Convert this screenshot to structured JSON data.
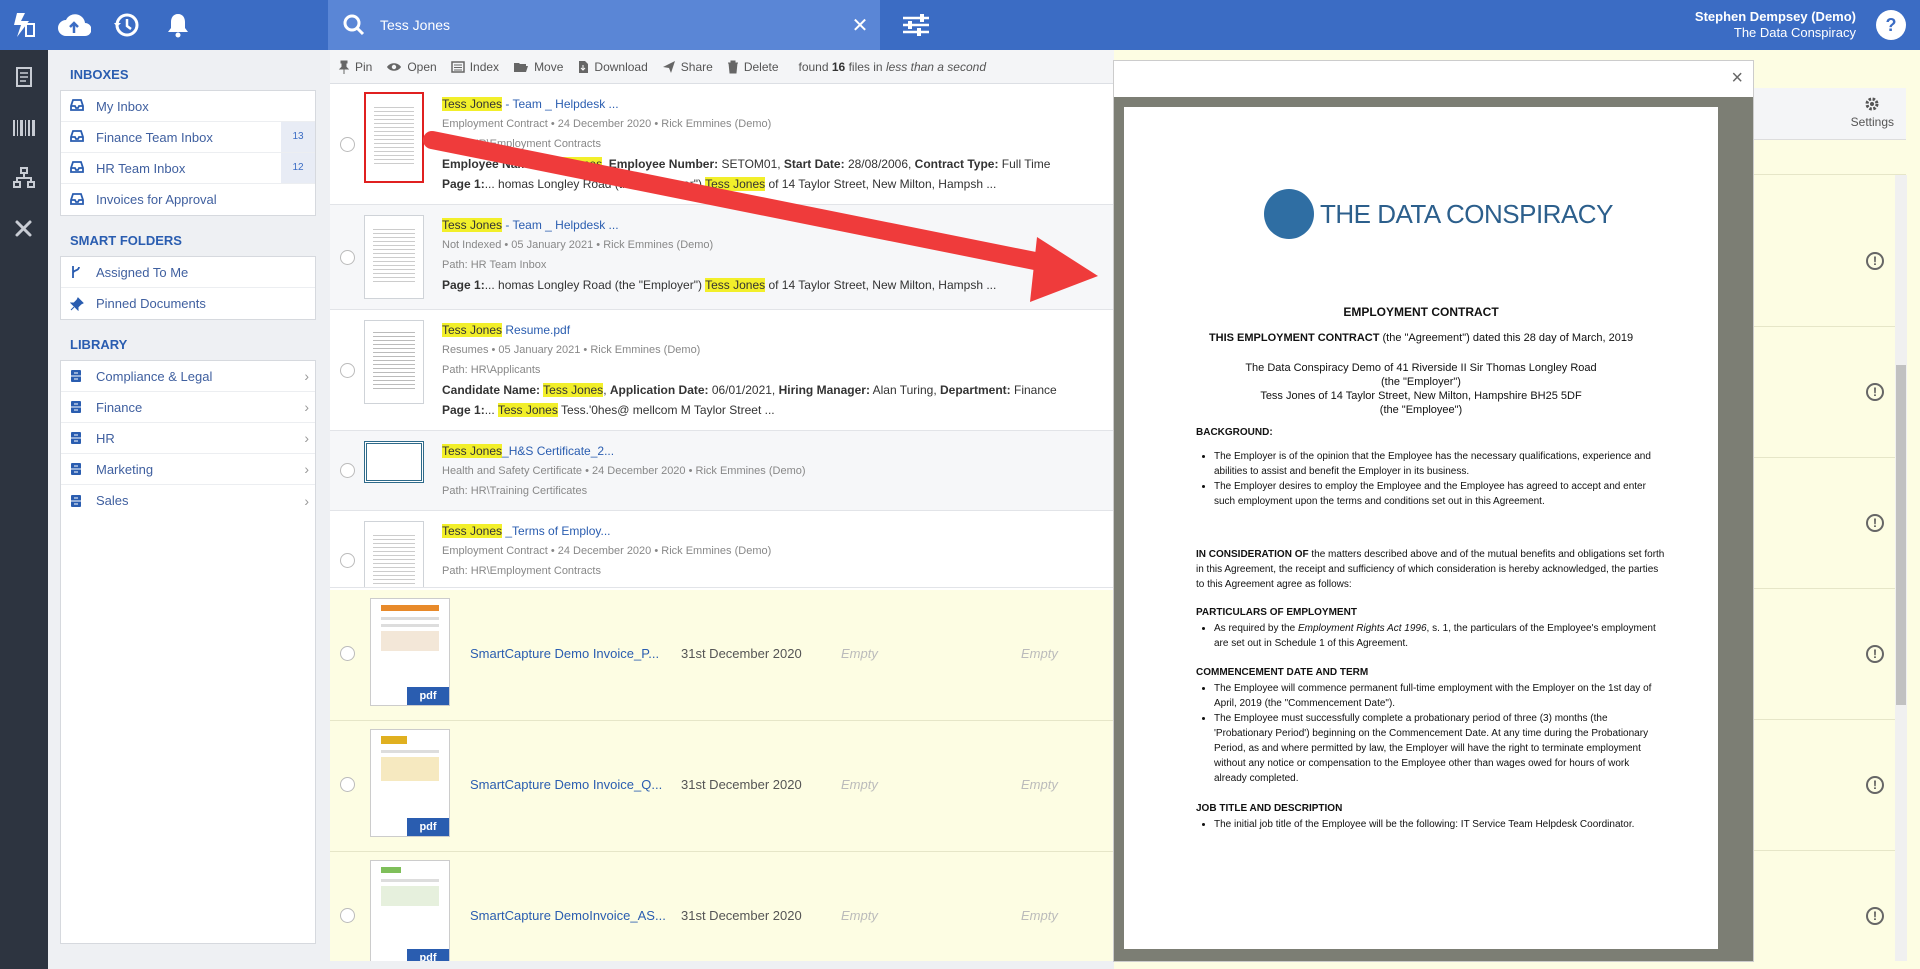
{
  "topbar": {
    "search_value": "Tess Jones",
    "user_name": "Stephen Dempsey (Demo)",
    "company": "The Data Conspiracy",
    "help_label": "?",
    "clear_label": "✕"
  },
  "sidebar": {
    "inboxes_title": "INBOXES",
    "inboxes": [
      {
        "label": "My Inbox",
        "count": ""
      },
      {
        "label": "Finance Team Inbox",
        "count": "13"
      },
      {
        "label": "HR Team Inbox",
        "count": "12"
      },
      {
        "label": "Invoices for Approval",
        "count": ""
      }
    ],
    "smart_title": "SMART FOLDERS",
    "smart": [
      {
        "label": "Assigned To Me"
      },
      {
        "label": "Pinned Documents"
      }
    ],
    "library_title": "LIBRARY",
    "library": [
      {
        "label": "Compliance & Legal"
      },
      {
        "label": "Finance"
      },
      {
        "label": "HR"
      },
      {
        "label": "Marketing"
      },
      {
        "label": "Sales"
      }
    ]
  },
  "toolbar": {
    "pin": "Pin",
    "open": "Open",
    "index": "Index",
    "move": "Move",
    "download": "Download",
    "share": "Share",
    "delete": "Delete",
    "found_prefix": "found",
    "found_count": "16",
    "found_mid": "files in",
    "found_time": "less than a second"
  },
  "results": [
    {
      "hl": "Tess Jones",
      "title": " - Team _ Helpdesk ...",
      "meta": "Employment Contract • 24 December 2020 • Rick Emmines (Demo)",
      "path": "Path: HR\\Employment Contracts",
      "t1a": "Employee Name: ",
      "t1hl": "Tess Jones",
      "t1b": ", ",
      "t1c": "Employee Number:",
      "t1d": " SETOM01, ",
      "t1e": "Start Date:",
      "t1f": " 28/08/2006, ",
      "t1g": "Contract Type:",
      "t1h": " Full Time",
      "p_label": "Page 1:",
      "p_a": "... homas Longley Road (the \"Employer\") ",
      "p_hl": "Tess Jones",
      "p_b": " of 14 Taylor Street, New Milton, Hampsh ..."
    },
    {
      "hl": "Tess Jones",
      "title": " - Team _ Helpdesk ...",
      "meta": "Not Indexed • 05 January 2021 • Rick Emmines (Demo)",
      "path": "Path: HR Team Inbox",
      "p_label": "Page 1:",
      "p_a": "... homas Longley Road (the \"Employer\") ",
      "p_hl": "Tess Jones",
      "p_b": " of 14 Taylor Street, New Milton, Hampsh ..."
    },
    {
      "hl": "Tess Jones",
      "title": " Resume.pdf",
      "meta": "Resumes • 05 January 2021 • Rick Emmines (Demo)",
      "path": "Path: HR\\Applicants",
      "c1": "Candidate Name:",
      "c1hl": "Tess Jones",
      "c2": "Application Date:",
      "c2v": " 06/01/2021, ",
      "c3": "Hiring Manager:",
      "c3v": " Alan Turing, ",
      "c4": "Department:",
      "c4v": " Finance",
      "p_label": "Page 1:",
      "p_a": "... ",
      "p_hl": "Tess Jones",
      "p_b": " Tess.'0hes@ mellcom M Taylor Street ..."
    },
    {
      "hl": "Tess Jones",
      "title": "_H&S Certificate_2...",
      "meta": "Health and Safety Certificate • 24 December 2020 • Rick Emmines (Demo)",
      "path": "Path: HR\\Training Certificates"
    },
    {
      "hl": "Tess Jones",
      "title": " _Terms of Employ...",
      "meta": "Employment Contract • 24 December 2020 • Rick Emmines (Demo)",
      "path": "Path: HR\\Employment Contracts"
    }
  ],
  "invoices": [
    {
      "name": "SmartCapture Demo Invoice_P...",
      "date": "31st December 2020",
      "e1": "Empty",
      "e2": "Empty",
      "badge": "pdf"
    },
    {
      "name": "SmartCapture Demo Invoice_Q...",
      "date": "31st December 2020",
      "e1": "Empty",
      "e2": "Empty",
      "badge": "pdf"
    },
    {
      "name": "SmartCapture DemoInvoice_AS...",
      "date": "31st December 2020",
      "e1": "Empty",
      "e2": "Empty",
      "badge": "pdf"
    }
  ],
  "settings_label": "Settings",
  "modal": {
    "close": "×",
    "brand": "THE DATA CONSPIRACY",
    "doc_title": "EMPLOYMENT CONTRACT",
    "intro_bold": "THIS EMPLOYMENT CONTRACT",
    "intro_rest": " (the \"Agreement\") dated this 28 day of March, 2019",
    "party1": "The Data Conspiracy Demo of 41 Riverside II Sir Thomas Longley Road",
    "party1b": "(the \"Employer\")",
    "party2": "Tess Jones of 14 Taylor Street, New Milton, Hampshire BH25 5DF",
    "party2b": "(the \"Employee\")",
    "bg_head": "BACKGROUND:",
    "bg1": "The Employer is of the opinion that the Employee has the necessary qualifications, experience and abilities to assist and benefit the Employer in its business.",
    "bg2": "The Employer desires to employ the Employee and the Employee has agreed to accept and enter such employment upon the terms and conditions set out in this Agreement.",
    "consid_bold": "IN CONSIDERATION OF",
    "consid_rest": " the matters described above and of the mutual benefits and obligations set forth in this Agreement, the receipt and sufficiency of which consideration is hereby acknowledged, the parties to this Agreement agree as follows:",
    "part_head": "PARTICULARS OF EMPLOYMENT",
    "part1a": "As required by the ",
    "part1i": "Employment Rights Act 1996",
    "part1b": ", s. 1, the particulars of the Employee's employment are set out in Schedule 1 of this Agreement.",
    "comm_head": "COMMENCEMENT DATE AND TERM",
    "comm1": "The Employee will commence permanent full-time employment with the Employer on the 1st day of April, 2019 (the \"Commencement Date\").",
    "comm2": "The Employee must successfully complete a probationary period of three (3) months (the 'Probationary Period') beginning on the Commencement Date. At any time during the Probationary Period, as and where permitted by law, the Employer will have the right to terminate employment without any notice or compensation to the Employee other than wages owed for hours of work already completed.",
    "job_head": "JOB TITLE AND DESCRIPTION",
    "job1": "The initial job title of the Employee will be the following: IT Service Team Helpdesk Coordinator."
  },
  "colors": {
    "brand_blue": "#3b6cc4",
    "highlight": "#f2ef2a",
    "arrow_red": "#ef3b3b"
  }
}
